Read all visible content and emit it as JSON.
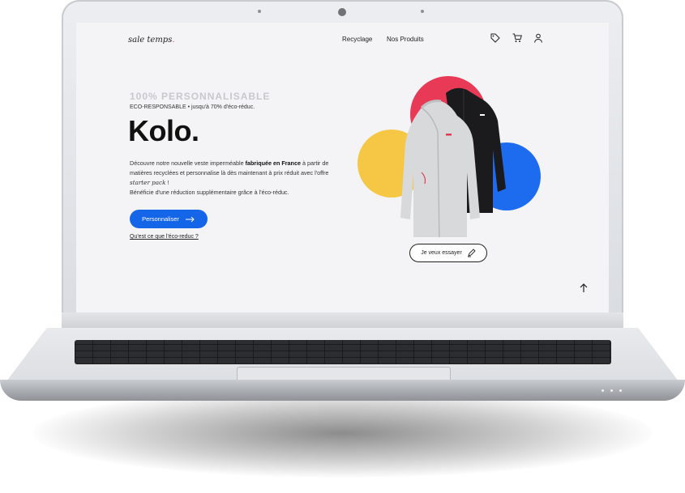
{
  "brand": {
    "logo_text": "sale temps",
    "logo_dot": "."
  },
  "nav": {
    "items": [
      "Recycylage",
      "Nos Produits"
    ],
    "recycling": "Recyclage",
    "products": "Nos Produits"
  },
  "header_icons": [
    "tag-icon",
    "cart-icon",
    "user-icon"
  ],
  "hero": {
    "kicker": "100%  PERSONNALISABLE",
    "subline": "ECO-RESPONSABLE • jusqu'à 70% d'éco-réduc.",
    "title": "Kolo.",
    "desc_part1": "Découvre notre nouvelle veste imperméable ",
    "desc_bold": "fabriquée en France",
    "desc_part2": " à partir de matières recyclées et personnalise là dès maintenant à prix réduit avec l'offre ",
    "desc_script": "starter pack",
    "desc_excl": " !",
    "desc_line2": "Bénéficie d'une réduction supplémentaire grâce à l'éco-réduc.",
    "cta_label": "Personnaliser",
    "eco_link": "Qu'est ce que l'éco-reduc ?"
  },
  "product": {
    "try_label": "Je veux essayer"
  },
  "colors": {
    "accent_blue": "#1565e8",
    "red": "#e83a56",
    "yellow": "#f6c744",
    "blue": "#1d6cf0"
  }
}
